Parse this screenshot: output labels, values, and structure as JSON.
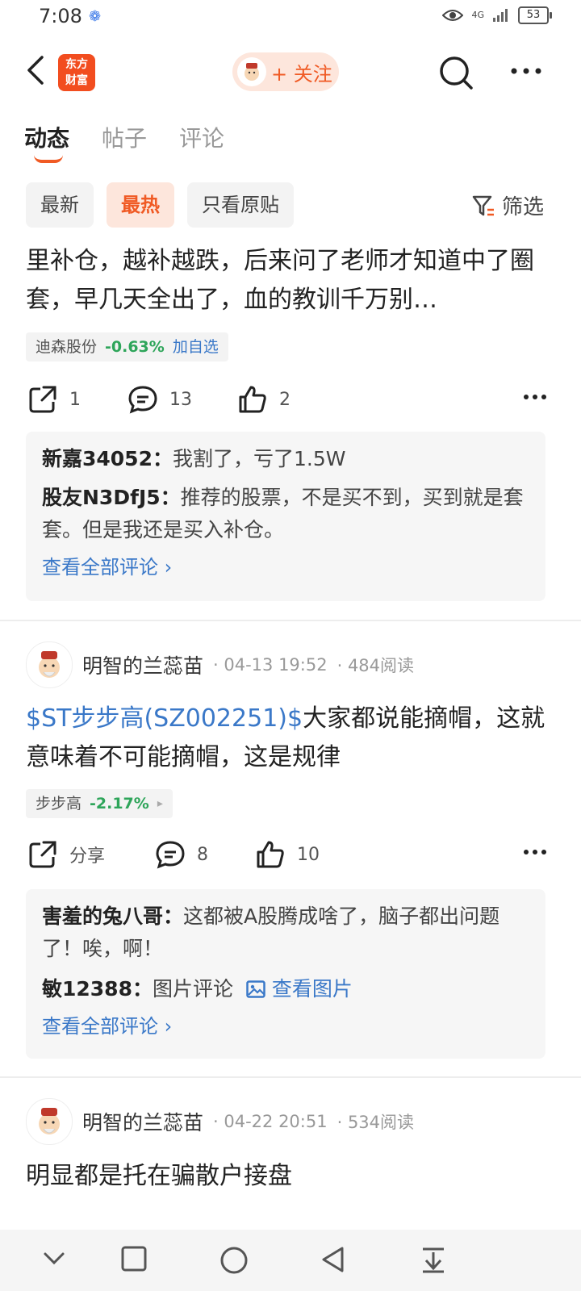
{
  "status": {
    "time": "7:08",
    "network": "4G",
    "battery": "53"
  },
  "header": {
    "logo_line1": "东方",
    "logo_line2": "财富",
    "follow_label": "+ 关注"
  },
  "tabs": [
    "动态",
    "帖子",
    "评论"
  ],
  "filters": {
    "chips": [
      "最新",
      "最热",
      "只看原贴"
    ],
    "filter_label": "筛选"
  },
  "post1": {
    "text": "里补仓，越补越跌，后来问了老师才知道中了圈套，早几天全出了，血的教训千万别…",
    "stock": {
      "name": "迪森股份",
      "change": "-0.63%",
      "action": "加自选"
    },
    "share_count": "1",
    "comment_count": "13",
    "like_count": "2",
    "comments": [
      {
        "user": "新嘉34052",
        "text": "我割了，亏了1.5W"
      },
      {
        "user": "股友N3DfJ5",
        "text": "推荐的股票，不是买不到，买到就是套套。但是我还是买入补仓。"
      }
    ],
    "view_all": "查看全部评论 ›"
  },
  "post2": {
    "author": "明智的兰蕊苗",
    "time": "· 04-13 19:52",
    "reads": "· 484阅读",
    "link_text": "$ST步步高(SZ002251)$",
    "text": "大家都说能摘帽，这就意味着不可能摘帽，这是规律",
    "stock": {
      "name": "步步高",
      "change": "-2.17%",
      "arrow": "▸"
    },
    "share_label": "分享",
    "comment_count": "8",
    "like_count": "10",
    "comments": [
      {
        "user": "害羞的兔八哥",
        "text": "这都被A股腾成啥了，脑子都出问题了！唉，啊！"
      },
      {
        "user": "敏12388",
        "text": "图片评论",
        "link": "查看图片"
      }
    ],
    "view_all": "查看全部评论 ›"
  },
  "post3": {
    "author": "明智的兰蕊苗",
    "time": "· 04-22 20:51",
    "reads": "· 534阅读",
    "text": "明显都是托在骗散户接盘"
  },
  "colors": {
    "accent": "#f05a24",
    "link": "#3a78c8",
    "down": "#2ea55a"
  }
}
